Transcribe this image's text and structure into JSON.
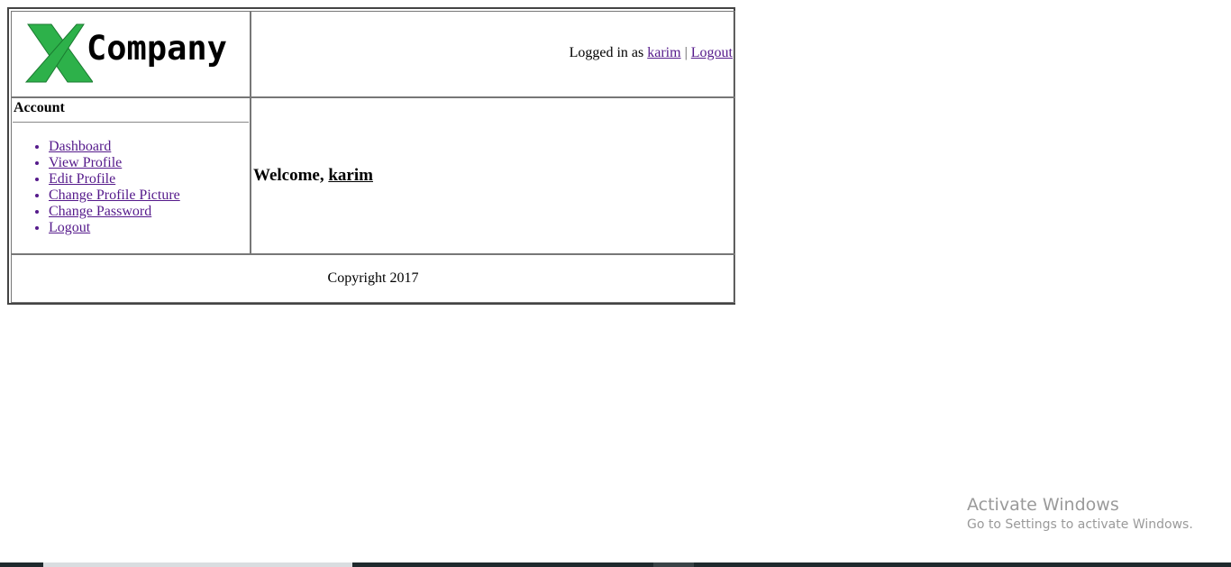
{
  "header": {
    "logo_letter": "X",
    "logo_text": "Company",
    "logo_color": "#2db14a",
    "logged_in_prefix": "Logged in as",
    "username": "karim",
    "separator": "|",
    "logout_label": "Logout"
  },
  "sidebar": {
    "title": "Account",
    "items": [
      {
        "label": "Dashboard"
      },
      {
        "label": "View Profile"
      },
      {
        "label": "Edit Profile"
      },
      {
        "label": "Change Profile Picture"
      },
      {
        "label": "Change Password"
      },
      {
        "label": "Logout"
      }
    ]
  },
  "main": {
    "welcome_prefix": "Welcome,",
    "welcome_user": "karim"
  },
  "footer": {
    "copyright": "Copyright 2017"
  },
  "windows_watermark": {
    "title": "Activate Windows",
    "subtitle": "Go to Settings to activate Windows."
  },
  "colors": {
    "link_visited": "#551a8b",
    "border": "#777777",
    "logo_green": "#2db14a",
    "taskbar": "#1f2a2d"
  }
}
